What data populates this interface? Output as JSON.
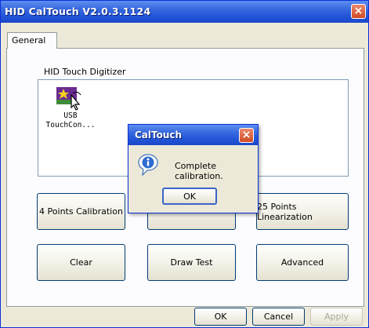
{
  "window": {
    "title": "HID CalTouch V2.0.3.1124",
    "close_glyph": "×"
  },
  "tabs": [
    {
      "label": "General",
      "active": true
    }
  ],
  "device_group": {
    "label": "HID Touch Digitizer",
    "device": {
      "icon": "touch-device-icon",
      "name_line1": "USB",
      "name_line2": "TouchCon..."
    }
  },
  "actions": {
    "four_points": "4 Points Calibration",
    "hidden_middle": "",
    "twentyfive_points": "25 Points Linearization",
    "clear": "Clear",
    "draw_test": "Draw Test",
    "advanced": "Advanced"
  },
  "footer": {
    "ok": "OK",
    "cancel": "Cancel",
    "apply": "Apply"
  },
  "dialog": {
    "title": "CalTouch",
    "message": "Complete calibration.",
    "ok": "OK",
    "icon": "information-icon",
    "close_glyph": "×"
  },
  "colors": {
    "titlebar": "#2255d8",
    "face": "#ece9d8",
    "close": "#d24a23"
  }
}
